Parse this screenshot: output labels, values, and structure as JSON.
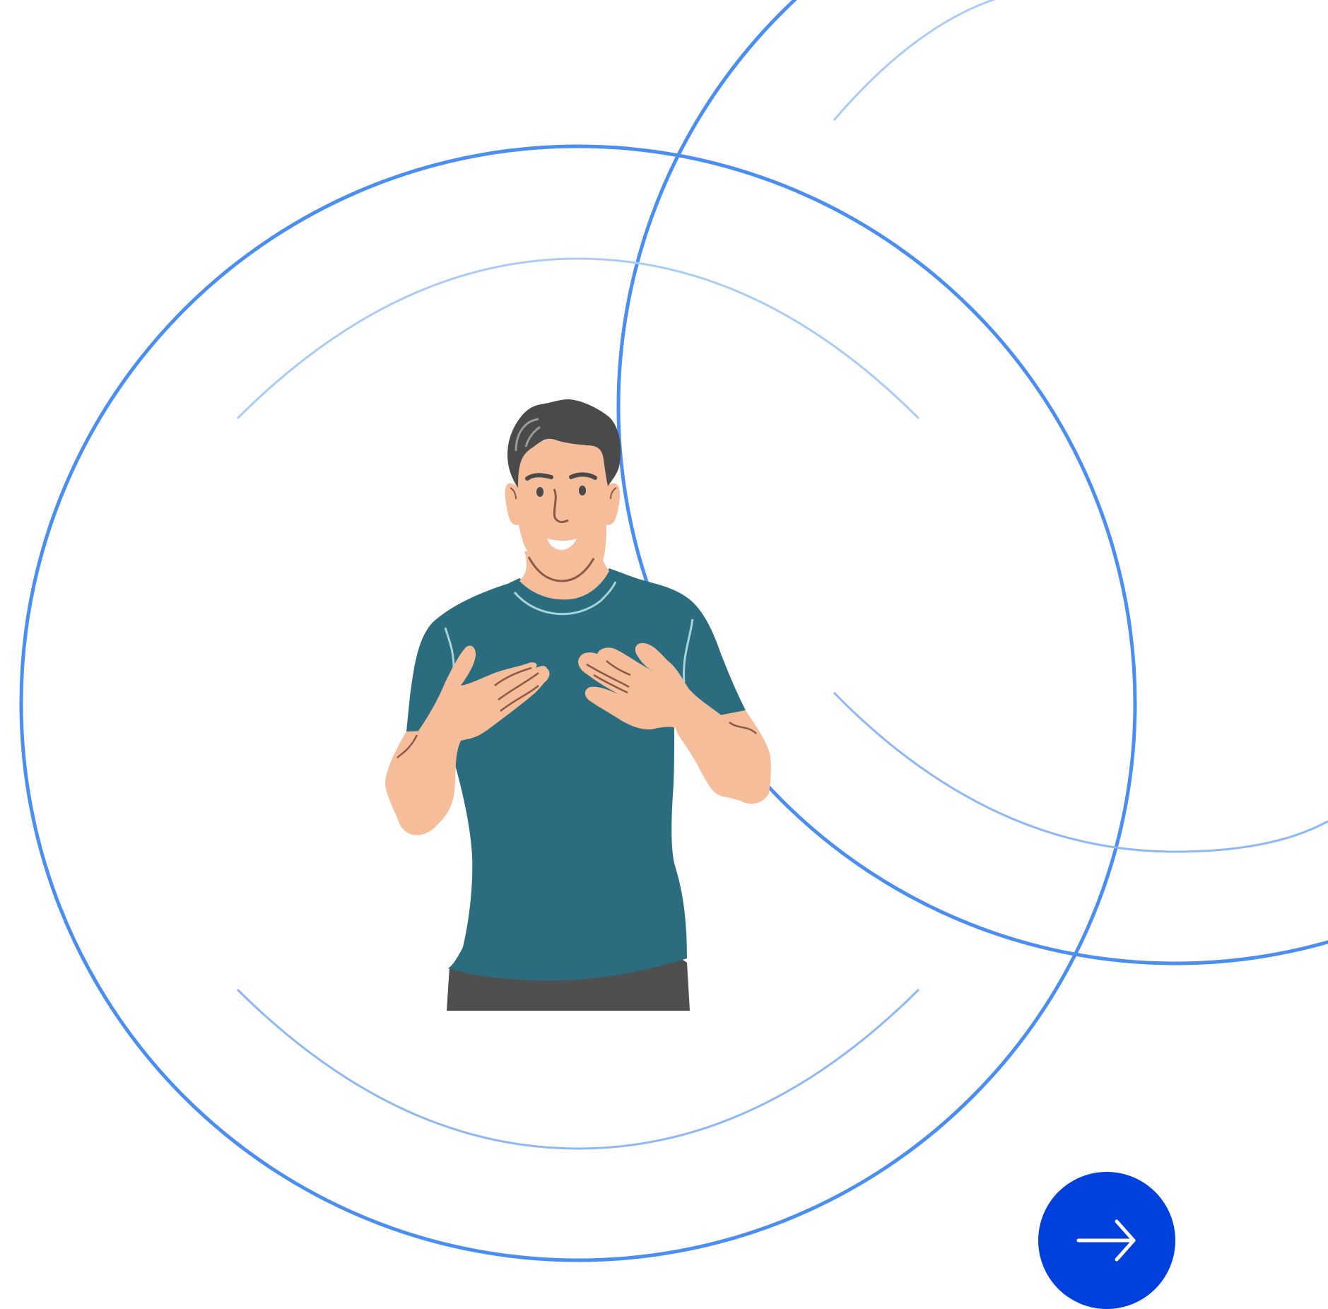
{
  "colors": {
    "background": "#ffffff",
    "ring_primary": "#4A8EF2",
    "ring_light": "#A9CCF7",
    "ring_mid": "#8DB8F3",
    "skin": "#F5BD9A",
    "skin_line": "#8A5A44",
    "hair": "#4A4A4A",
    "shirt": "#2B6C7E",
    "shirt_highlight": "#A9D3DB",
    "pants": "#4F4F4F",
    "button_bg": "#0040DD",
    "button_icon": "#ffffff"
  },
  "illustration": {
    "subject": "man-gesturing-to-self"
  },
  "next_button": {
    "icon": "arrow-right-icon"
  }
}
